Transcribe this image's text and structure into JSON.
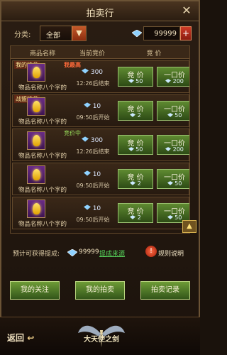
{
  "header": {
    "title": "拍卖行",
    "close_icon": "close-icon"
  },
  "filter": {
    "label": "分类:",
    "selected": "全部",
    "currency_value": "99999",
    "plus": "+"
  },
  "table": {
    "headers": [
      "商品名称",
      "当前竞价",
      "竞 价"
    ],
    "rows": [
      {
        "tag_left": "我的拍品",
        "tag_right": "我最高",
        "name": "物品名称八个字的",
        "price": "300",
        "time": "12:26后结束",
        "bid_label": "竞 价",
        "bid_value": "50",
        "buy_label": "一口价",
        "buy_value": "200",
        "tag_right_type": "hot"
      },
      {
        "tag_left": "战盟拍品",
        "tag_right": "",
        "name": "物品名称八个字的",
        "price": "10",
        "time": "09:50后开始",
        "bid_label": "竞 价",
        "bid_value": "2",
        "buy_label": "一口价",
        "buy_value": "50",
        "tag_right_type": ""
      },
      {
        "tag_left": "",
        "tag_right": "竞价中",
        "name": "物品名称八个字的",
        "price": "300",
        "time": "12:26后结束",
        "bid_label": "竞 价",
        "bid_value": "50",
        "buy_label": "一口价",
        "buy_value": "200",
        "tag_right_type": "green"
      },
      {
        "tag_left": "",
        "tag_right": "",
        "name": "物品名称八个字的",
        "price": "10",
        "time": "09:50后开始",
        "bid_label": "竞 价",
        "bid_value": "2",
        "buy_label": "一口价",
        "buy_value": "50",
        "tag_right_type": ""
      },
      {
        "tag_left": "",
        "tag_right": "",
        "name": "物品名称八个字的",
        "price": "10",
        "time": "09:50后开始",
        "bid_label": "竞 价",
        "bid_value": "2",
        "buy_label": "一口价",
        "buy_value": "50",
        "tag_right_type": ""
      }
    ]
  },
  "info": {
    "estimate_label": "预计可获得提成:",
    "estimate_value": "99999",
    "source_link": "提成来源",
    "rule_label": "规则说明"
  },
  "actions": [
    "我的关注",
    "我的拍卖",
    "拍卖记录"
  ],
  "footer": {
    "back": "返回",
    "logo_text": "大天使之剑"
  },
  "colors": {
    "accent_green": "#6d9b36",
    "accent_red": "#cf3a26",
    "gold": "#e0a100"
  }
}
